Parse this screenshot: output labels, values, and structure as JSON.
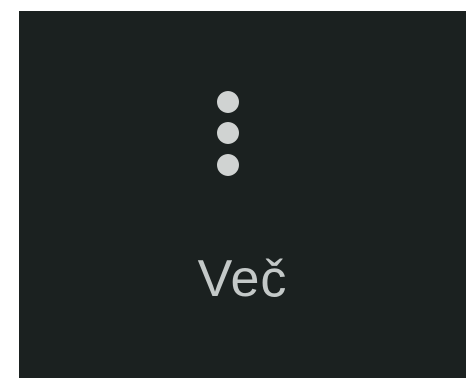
{
  "more_item": {
    "icon": "more-vertical-icon",
    "label": "Več",
    "colors": {
      "background": "#1b2120",
      "icon": "#d0d3d2",
      "text": "#c4c9c8"
    }
  }
}
